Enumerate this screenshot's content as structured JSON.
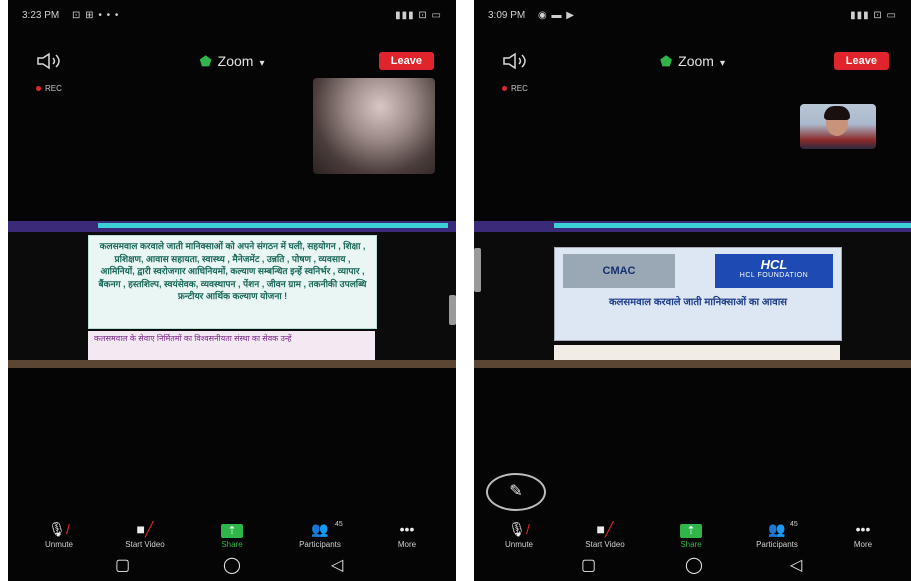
{
  "left_phone": {
    "status": {
      "time": "3:23 PM",
      "left_icons": "⊡ ⊞ • • •",
      "right_icons": "▮▮▮ ⊡ ▭"
    },
    "meeting_title": "Zoom",
    "leave_label": "Leave",
    "rec_label": "REC",
    "slide": {
      "main_text": "कलसमवाल करवाले जाती मानिक्साओं को अपने संगठन में घली, सहयोगन , शिक्षा , प्रशिक्षण, आवास सहायता, स्वास्थ्य , मैनेजमेंट , उन्नति , पोषण , व्यवसाय , आमिनियों, द्वारी स्वरोजगार आधिनियमों, कल्याण सम्बन्धित इन्हें स्वनिर्भर , व्यापार , बैंकनग , हस्तशिल्प, स्वयंसेवक, व्यवस्थापन , पेंशन , जीवन ग्राम , तकनीकी उपलब्धि फ्रन्टीयर आर्थिक कल्याण योजना !",
      "sub_text": "कलसमवाल के सेवाए निर्मितमों का विश्वसनीयता संस्था का सेवक उन्हें"
    },
    "toolbar": [
      {
        "label": "Unmute"
      },
      {
        "label": "Start Video"
      },
      {
        "label": "Share"
      },
      {
        "label": "Participants",
        "count": "45"
      },
      {
        "label": "More"
      }
    ]
  },
  "right_phone": {
    "status": {
      "time": "3:09 PM",
      "left_icons": "◉ ▬ ▶",
      "right_icons": "▮▮▮ ⊡ ▭"
    },
    "meeting_title": "Zoom",
    "leave_label": "Leave",
    "rec_label": "REC",
    "slide": {
      "logo_left": "CMAC",
      "logo_right_big": "HCL",
      "logo_right_small": "HCL FOUNDATION",
      "caption": "कलसमवाल करवाले जाती मानिक्साओं का आवास"
    },
    "toolbar": [
      {
        "label": "Unmute"
      },
      {
        "label": "Start Video"
      },
      {
        "label": "Share"
      },
      {
        "label": "Participants",
        "count": "45"
      },
      {
        "label": "More"
      }
    ]
  },
  "colors": {
    "leave_red": "#e0242b",
    "share_green": "#2fb54a",
    "background": "#050505",
    "share_bar_purple": "#3a2a78"
  },
  "icons": {
    "speaker": "speaker-icon",
    "shield": "shield-icon",
    "unmute": "microphone-muted-icon",
    "video": "video-off-icon",
    "share": "share-up-arrow-icon",
    "participants": "participants-icon",
    "more": "more-dots-icon",
    "pencil": "pencil-icon"
  }
}
